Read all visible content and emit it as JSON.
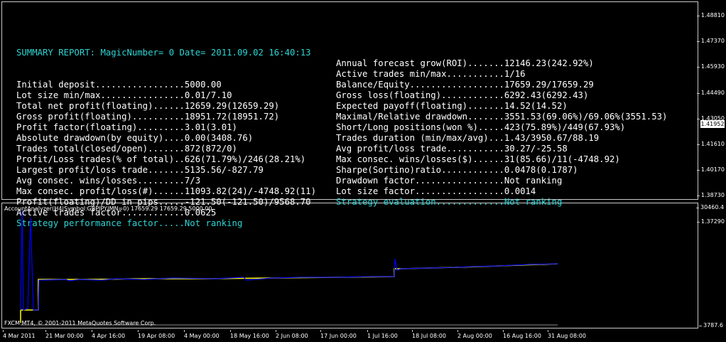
{
  "report": {
    "title": "SUMMARY REPORT: MagicNumber= 0 Date= 2011.09.02 16:40:13",
    "left": [
      {
        "text": "Initial deposit.................5000.00",
        "style": "w"
      },
      {
        "text": "Lot size min/max................0.01/7.10",
        "style": "w"
      },
      {
        "text": "Total net profit(floating)......12659.29(12659.29)",
        "style": "w"
      },
      {
        "text": "Gross profit(floating)..........18951.72(18951.72)",
        "style": "w"
      },
      {
        "text": "Profit factor(floating).........3.01(3.01)",
        "style": "w"
      },
      {
        "text": "Absolute drawdown(by equity)....0.00(3408.76)",
        "style": "w"
      },
      {
        "text": "Trades total(closed/open).......872(872/0)",
        "style": "w"
      },
      {
        "text": "Profit/Loss trades(% of total)..626(71.79%)/246(28.21%)",
        "style": "w"
      },
      {
        "text": "Largest profit/loss trade.......5135.56/-827.79",
        "style": "w"
      },
      {
        "text": "Avg consec. wins/losses.........7/3",
        "style": "w"
      },
      {
        "text": "Max consec. profit/loss(#)......11093.82(24)/-4748.92(11)",
        "style": "w"
      },
      {
        "text": "Profit(floating)/DD in pips.....-121.50(-121.50)/9568.70",
        "style": "w"
      },
      {
        "text": "Active trades factor............0.0625",
        "style": "w"
      },
      {
        "text": "Strategy performance factor.....Not ranking",
        "style": "c"
      }
    ],
    "right": [
      {
        "text": "Annual forecast grow(ROI).......12146.23(242.92%)",
        "style": "w"
      },
      {
        "text": "Active trades min/max...........1/16",
        "style": "w"
      },
      {
        "text": "Balance/Equity..................17659.29/17659.29",
        "style": "w"
      },
      {
        "text": "Gross loss(floating)............6292.43(6292.43)",
        "style": "w"
      },
      {
        "text": "Expected payoff(floating).......14.52(14.52)",
        "style": "w"
      },
      {
        "text": "Maximal/Relative drawdown.......3551.53(69.06%)/69.06%(3551.53)",
        "style": "w"
      },
      {
        "text": "Short/Long positions(won %).....423(75.89%)/449(67.93%)",
        "style": "w"
      },
      {
        "text": "Trades duration (min/max/avg)...1.43/3950.67/88.19",
        "style": "w"
      },
      {
        "text": "Avg profit/loss trade...........30.27/-25.58",
        "style": "w"
      },
      {
        "text": "Max consec. wins/losses($)......31(85.66)/11(-4748.92)",
        "style": "w"
      },
      {
        "text": "Sharpe(Sortino)ratio............0.0478(0.1787)",
        "style": "w"
      },
      {
        "text": "Drawdown factor.................Not ranking",
        "style": "w"
      },
      {
        "text": "Lot size factor.................0.0014",
        "style": "w"
      },
      {
        "text": "Strategy evaluation.............Not ranking",
        "style": "c"
      }
    ]
  },
  "price_scale": [
    "1.48810",
    "1.47370",
    "1.45930",
    "1.44490",
    "1.43050",
    "1.41610",
    "1.40170",
    "1.38730",
    "1.37290"
  ],
  "current_price": "1.41952",
  "indicator": {
    "title": "AccountAnalyzer(H4|Symbol:GBPJPY|MN=0) 17659.29 17659.29 5000.00",
    "scale_top": "30460.4",
    "scale_bottom": "3787.6",
    "y_range": [
      3787.6,
      30460.4
    ]
  },
  "copyright": "FXCM MT4, © 2001-2011 MetaQuotes Software Corp.",
  "time_axis": [
    "4 Mar 2011",
    "21 Mar 00:00",
    "4 Apr 16:00",
    "19 Apr 08:00",
    "4 May 00:00",
    "18 May 16:00",
    "2 Jun 08:00",
    "17 Jun 00:00",
    "1 Jul 16:00",
    "18 Jul 08:00",
    "2 Aug 00:00",
    "16 Aug 16:00",
    "31 Aug 08:00"
  ],
  "colors": {
    "balance": "#ffff00",
    "equity": "#0000ff",
    "cyan_text": "#2fd4d4"
  }
}
